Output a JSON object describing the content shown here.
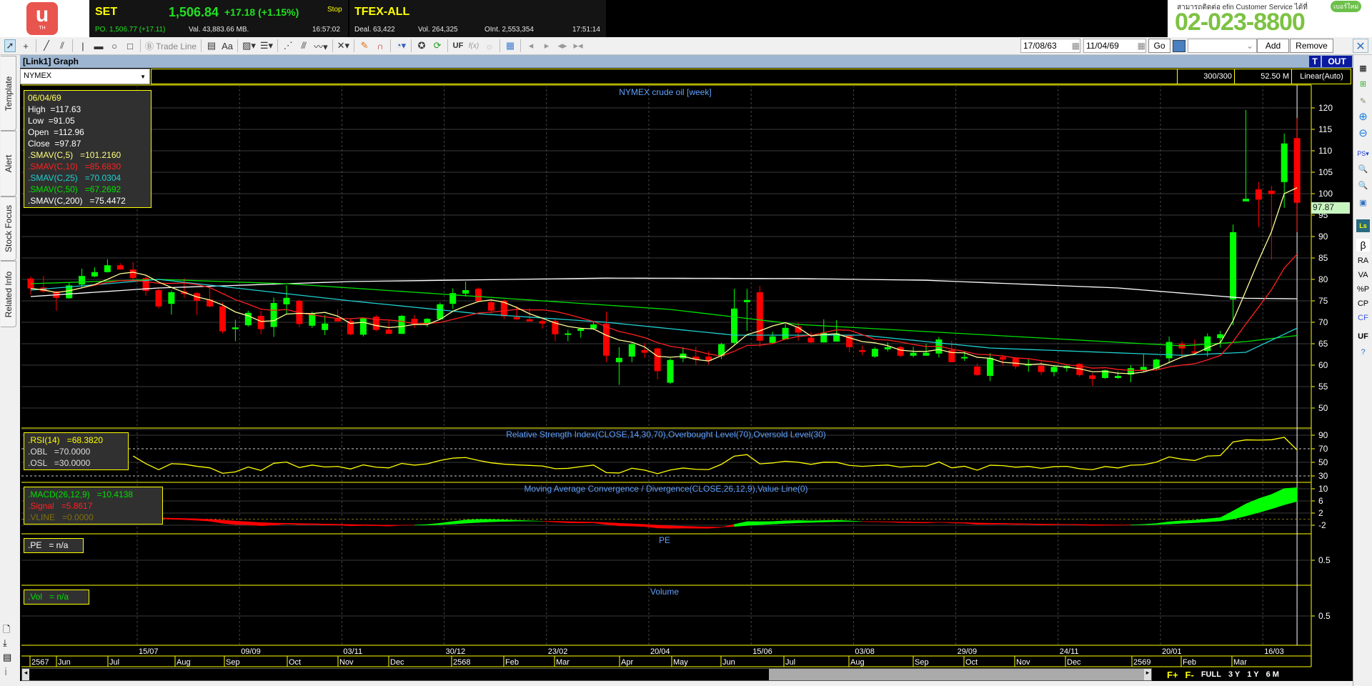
{
  "header": {
    "logo_text": "TH",
    "set": {
      "name": "SET",
      "price": "1,506.84",
      "change": "+17.18 (+1.15%)",
      "status": "Stop",
      "po": "PO. 1,506.77 (+17.11)",
      "val": "Val. 43,883.66 MB.",
      "time": "16:57:02"
    },
    "tfex": {
      "name": "TFEX-ALL",
      "deal": "Deal. 63,422",
      "vol": "Vol. 264,325",
      "oint": "OInt. 2,553,354",
      "time": "17:51:14"
    },
    "ad": {
      "line": "สามารถติดต่อ efin Customer Service ได้ที่",
      "badge": "เบอร์ใหม่",
      "phone": "02-023-8800"
    }
  },
  "toolbar": {
    "trade_line": "Trade Line",
    "aa": "Aa",
    "uf": "UF",
    "fx": "f(x)",
    "date_from": "17/08/63",
    "date_to": "11/04/69",
    "go": "Go",
    "template_select": "",
    "add": "Add",
    "remove": "Remove"
  },
  "sidebar": {
    "tabs": [
      "Template",
      "Alert",
      "Stock Focus",
      "Related Info"
    ]
  },
  "graph": {
    "title": "[Link1] Graph",
    "t_btn": "T",
    "out_btn": "OUT",
    "symbol": "NYMEX",
    "count": "300/300",
    "volume_info": "52.50 M",
    "scale": "Linear(Auto)"
  },
  "info": {
    "date": "06/04/69",
    "high": "High  =117.63",
    "low": "Low  =91.05",
    "open": "Open  =112.96",
    "close": "Close  =97.87",
    "sma5": ".SMAV(C,5)   =101.2160",
    "sma10": ".SMAV(C,10)   =85.6830",
    "sma25": ".SMAV(C,25)   =70.0304",
    "sma50": ".SMAV(C,50)   =67.2692",
    "sma200": ".SMAV(C,200)   =75.4472"
  },
  "rsi_box": {
    "rsi": ".RSI(14)   =68.3820",
    "obl": ".OBL   =70.0000",
    "osl": ".OSL   =30.0000"
  },
  "macd_box": {
    "macd": ".MACD(26,12,9)   =10.4138",
    "signal": ".Signal   =5.8617",
    "vline": ".VLINE   =0.0000"
  },
  "pe_box": {
    "pe": ".PE   = n/a"
  },
  "vol_box": {
    "vol": ".Vol   = n/a"
  },
  "last_price": "97.87",
  "bottom": {
    "f_plus": "F+",
    "f_minus": "F-",
    "full": "FULL",
    "y3": "3 Y",
    "y1": "1 Y",
    "m6": "6 M"
  },
  "right_toolbar": [
    "β",
    "RA",
    "VA",
    "%P",
    "CP",
    "CF",
    "UF"
  ],
  "colors": {
    "up": "#00ff00",
    "down": "#ff0000",
    "sma5": "#ffff99",
    "sma10": "#ff2020",
    "sma25": "#20d0d0",
    "sma50": "#00e000",
    "sma200": "#ffffff",
    "rsi": "#ffff00",
    "border": "#ffff00",
    "title": "#5fa0ff"
  },
  "chart_data": {
    "type": "candlestick",
    "title": "NYMEX crude oil [week]",
    "rsi_title": "Relative Strength Index(CLOSE,14,30,70),Overbought Level(70),Oversold Level(30)",
    "macd_title": "Moving Average Convergence / Divergence(CLOSE,26,12,9),Value Line(0)",
    "pe_title": "PE",
    "vol_title": "Volume",
    "y_ticks": [
      "120",
      "115",
      "110",
      "105",
      "100",
      "95",
      "90",
      "85",
      "80",
      "75",
      "70",
      "65",
      "60",
      "55",
      "50"
    ],
    "ylim": [
      45,
      121
    ],
    "rsi_ticks": [
      "90",
      "70",
      "50",
      "30"
    ],
    "macd_ticks": [
      "10",
      "6",
      "2",
      "-2"
    ],
    "pe_ticks": [
      "0.5"
    ],
    "vol_ticks": [
      "0.5"
    ],
    "date_ticks": [
      "15/07",
      "09/09",
      "03/11",
      "30/12",
      "23/02",
      "20/04",
      "15/06",
      "03/08",
      "29/09",
      "24/11",
      "20/01",
      "16/03"
    ],
    "month_ticks": [
      "2567",
      "Jun",
      "Jul",
      "Aug",
      "Sep",
      "Oct",
      "Nov",
      "Dec",
      "2568",
      "Feb",
      "Mar",
      "Apr",
      "May",
      "Jun",
      "Jul",
      "Aug",
      "Sep",
      "Oct",
      "Nov",
      "Dec",
      "2569",
      "Feb",
      "Mar"
    ],
    "ohlc": [
      [
        80.2,
        80.7,
        76.4,
        77.9
      ],
      [
        78.1,
        80.8,
        76.8,
        77.2
      ],
      [
        77.2,
        77.3,
        72.7,
        75.7
      ],
      [
        75.6,
        79.4,
        75.5,
        78.6
      ],
      [
        78.8,
        82.5,
        78.2,
        80.8
      ],
      [
        80.7,
        82.8,
        80.5,
        81.7
      ],
      [
        81.7,
        84.7,
        81.6,
        83.3
      ],
      [
        83.3,
        83.8,
        82.3,
        82.3
      ],
      [
        82.3,
        84.0,
        80.0,
        80.3
      ],
      [
        80.3,
        80.7,
        76.2,
        77.3
      ],
      [
        77.5,
        77.8,
        73.2,
        73.7
      ],
      [
        74.3,
        77.4,
        71.8,
        77.0
      ],
      [
        77.2,
        80.3,
        75.7,
        76.6
      ],
      [
        76.8,
        77.0,
        71.7,
        75.0
      ],
      [
        75.3,
        78.0,
        73.5,
        73.7
      ],
      [
        73.7,
        74.6,
        67.4,
        67.9
      ],
      [
        68.4,
        70.6,
        65.6,
        68.8
      ],
      [
        69.3,
        72.7,
        69.0,
        72.2
      ],
      [
        71.5,
        72.7,
        67.2,
        68.4
      ],
      [
        68.9,
        75.8,
        66.6,
        74.5
      ],
      [
        74.2,
        78.6,
        71.8,
        75.7
      ],
      [
        75.0,
        75.3,
        68.9,
        69.6
      ],
      [
        69.2,
        72.5,
        68.7,
        72.0
      ],
      [
        68.2,
        71.7,
        67.0,
        69.7
      ],
      [
        70.8,
        73.0,
        70.2,
        70.2
      ],
      [
        70.3,
        70.8,
        67.0,
        67.2
      ],
      [
        67.1,
        71.1,
        66.7,
        70.9
      ],
      [
        71.3,
        71.7,
        67.9,
        68.2
      ],
      [
        68.3,
        70.6,
        67.3,
        67.3
      ],
      [
        67.3,
        71.7,
        67.3,
        71.5
      ],
      [
        70.8,
        71.7,
        68.7,
        69.6
      ],
      [
        69.6,
        71.0,
        68.9,
        70.8
      ],
      [
        70.7,
        74.6,
        70.5,
        74.2
      ],
      [
        74.3,
        77.9,
        73.1,
        76.8
      ],
      [
        76.7,
        79.5,
        76.0,
        77.5
      ],
      [
        77.8,
        78.1,
        74.8,
        74.9
      ],
      [
        74.7,
        75.2,
        72.1,
        72.7
      ],
      [
        75.0,
        75.3,
        70.7,
        71.4
      ],
      [
        71.2,
        73.8,
        70.6,
        70.7
      ],
      [
        70.7,
        73.3,
        70.2,
        70.2
      ],
      [
        70.3,
        70.7,
        68.5,
        69.7
      ],
      [
        70.3,
        70.8,
        65.6,
        67.2
      ],
      [
        67.2,
        68.2,
        65.6,
        67.4
      ],
      [
        68.0,
        68.8,
        66.4,
        68.5
      ],
      [
        68.5,
        70.3,
        68.2,
        69.5
      ],
      [
        69.7,
        72.5,
        60.7,
        62.2
      ],
      [
        60.7,
        64.2,
        55.4,
        61.7
      ],
      [
        62.0,
        65.2,
        60.7,
        64.9
      ],
      [
        63.5,
        65.2,
        61.7,
        62.9
      ],
      [
        63.9,
        64.2,
        56.7,
        58.6
      ],
      [
        55.9,
        61.6,
        55.6,
        61.2
      ],
      [
        61.6,
        64.2,
        60.7,
        62.7
      ],
      [
        62.0,
        64.3,
        60.1,
        61.3
      ],
      [
        62.0,
        63.3,
        60.1,
        61.0
      ],
      [
        62.1,
        65.2,
        61.4,
        64.9
      ],
      [
        65.2,
        77.8,
        64.9,
        73.2
      ],
      [
        74.7,
        77.8,
        68.0,
        75.2
      ],
      [
        77.0,
        78.5,
        64.2,
        65.7
      ],
      [
        65.2,
        67.8,
        64.9,
        66.7
      ],
      [
        66.0,
        69.6,
        66.0,
        68.7
      ],
      [
        69.0,
        69.9,
        65.7,
        67.6
      ],
      [
        66.4,
        67.7,
        65.1,
        65.3
      ],
      [
        65.3,
        70.7,
        65.3,
        67.5
      ],
      [
        65.5,
        70.5,
        65.5,
        67.4
      ],
      [
        67.0,
        67.0,
        63.0,
        64.2
      ],
      [
        63.5,
        64.6,
        62.3,
        63.1
      ],
      [
        62.0,
        64.2,
        61.7,
        63.8
      ],
      [
        63.7,
        65.3,
        63.2,
        64.2
      ],
      [
        64.2,
        64.5,
        61.9,
        62.2
      ],
      [
        62.2,
        64.3,
        61.8,
        62.9
      ],
      [
        62.2,
        65.0,
        62.2,
        62.9
      ],
      [
        62.7,
        66.6,
        61.8,
        66.0
      ],
      [
        63.5,
        65.7,
        60.7,
        60.7
      ],
      [
        61.6,
        63.2,
        61.0,
        61.9
      ],
      [
        59.7,
        60.4,
        57.5,
        57.7
      ],
      [
        57.5,
        62.8,
        56.3,
        61.7
      ],
      [
        61.9,
        62.4,
        59.9,
        61.3
      ],
      [
        61.7,
        61.7,
        59.1,
        59.7
      ],
      [
        59.9,
        61.4,
        58.5,
        60.3
      ],
      [
        59.9,
        60.9,
        57.7,
        58.4
      ],
      [
        58.4,
        59.8,
        57.4,
        59.6
      ],
      [
        59.3,
        60.2,
        58.5,
        59.8
      ],
      [
        60.3,
        60.5,
        57.3,
        57.7
      ],
      [
        57.6,
        58.1,
        55.2,
        56.8
      ],
      [
        57.0,
        59.0,
        56.8,
        58.8
      ],
      [
        57.0,
        58.5,
        56.8,
        57.5
      ],
      [
        57.8,
        60.0,
        56.0,
        59.3
      ],
      [
        58.9,
        62.5,
        58.5,
        59.6
      ],
      [
        59.2,
        61.5,
        58.8,
        61.3
      ],
      [
        61.6,
        66.7,
        60.4,
        65.4
      ],
      [
        65.0,
        65.6,
        61.6,
        63.9
      ],
      [
        63.2,
        66.0,
        62.7,
        63.0
      ],
      [
        63.3,
        67.4,
        62.0,
        66.7
      ],
      [
        66.3,
        68.0,
        64.1,
        67.2
      ],
      [
        75.3,
        92.8,
        69.3,
        91.0
      ],
      [
        98.2,
        119.5,
        98.2,
        98.8
      ],
      [
        101.0,
        102.7,
        92.2,
        98.6
      ],
      [
        100.7,
        101.8,
        84.6,
        99.9
      ],
      [
        102.7,
        114.0,
        96.7,
        111.7
      ],
      [
        112.96,
        117.63,
        91.05,
        97.87
      ]
    ],
    "sma25_knots": [
      [
        0,
        77.5
      ],
      [
        10,
        80
      ],
      [
        25,
        75
      ],
      [
        35,
        72
      ],
      [
        45,
        70
      ],
      [
        55,
        67
      ],
      [
        65,
        67
      ],
      [
        75,
        64
      ],
      [
        90,
        62.3
      ],
      [
        95,
        63
      ],
      [
        100,
        70.03
      ]
    ],
    "sma50_knots": [
      [
        0,
        79
      ],
      [
        10,
        80
      ],
      [
        20,
        79
      ],
      [
        35,
        76
      ],
      [
        50,
        73
      ],
      [
        60,
        69.5
      ],
      [
        75,
        67
      ],
      [
        90,
        64.5
      ],
      [
        95,
        65.5
      ],
      [
        100,
        67.27
      ]
    ],
    "sma200_knots": [
      [
        0,
        76
      ],
      [
        10,
        78
      ],
      [
        25,
        79.5
      ],
      [
        45,
        80.3
      ],
      [
        60,
        80.2
      ],
      [
        70,
        79.8
      ],
      [
        85,
        78
      ],
      [
        95,
        75.6
      ],
      [
        100,
        75.45
      ]
    ]
  }
}
